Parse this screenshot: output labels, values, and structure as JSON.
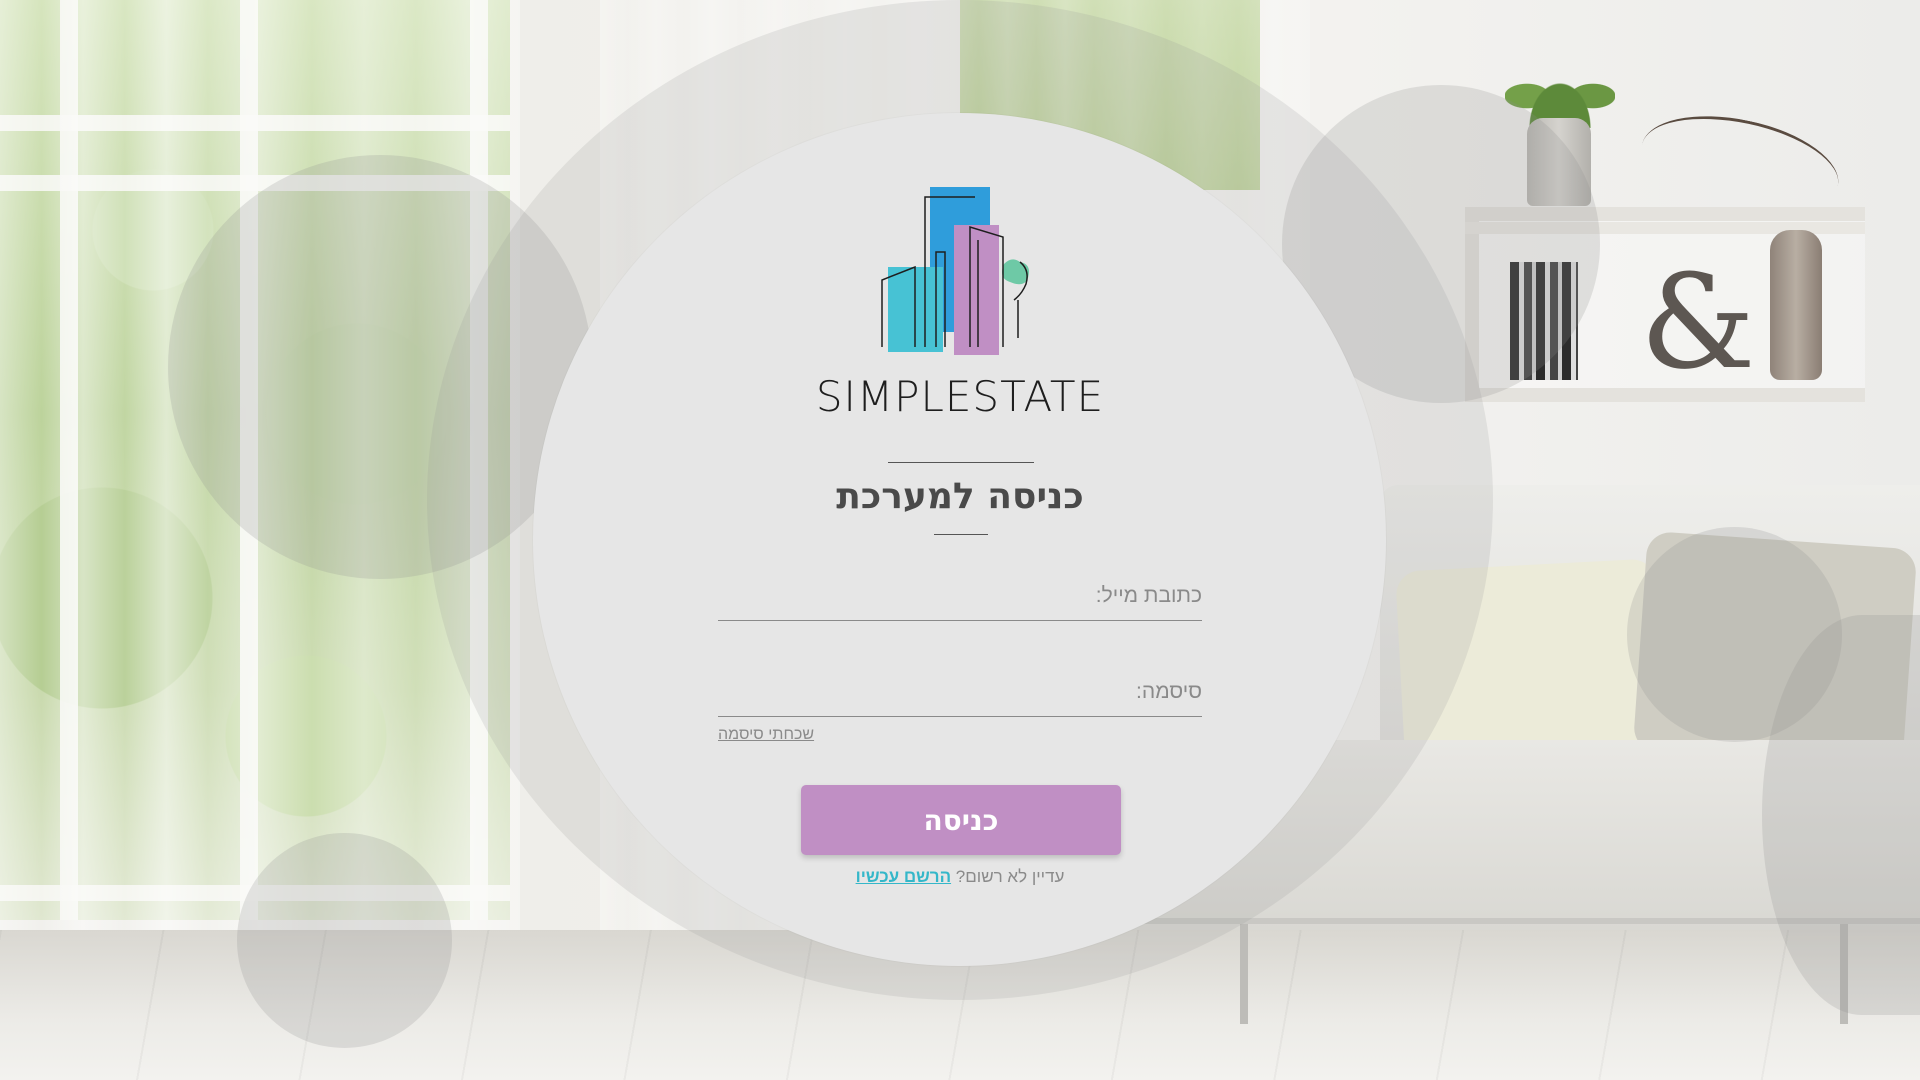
{
  "brand": {
    "name": "SIMPLESTATE",
    "logo_icon": "buildings-logo-icon",
    "colors": {
      "blue": "#2f9ddb",
      "teal": "#47c2d4",
      "purple": "#c08fc4",
      "green": "#6ec9a6"
    }
  },
  "login": {
    "title": "כניסה למערכת",
    "email_label": "כתובת מייל:",
    "email_value": "",
    "password_label": "סיסמה:",
    "password_value": "",
    "forgot_password": "שכחתי סיסמה",
    "submit_label": "כניסה",
    "not_registered": "עדיין לא רשום?",
    "register_now": "הרשם עכשיו"
  },
  "theme": {
    "accent_button": "#c08fc4",
    "link_color": "#34b7c9",
    "card_background": "#e6e6e6"
  }
}
